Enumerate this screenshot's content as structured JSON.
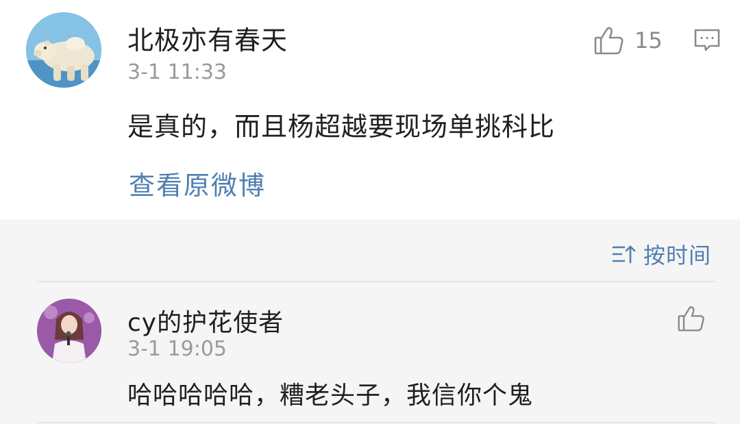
{
  "main_comment": {
    "username": "北极亦有春天",
    "timestamp": "3-1 11:33",
    "text": "是真的，而且杨超越要现场单挑科比",
    "view_original_label": "查看原微博",
    "like_count": "15",
    "avatar_icon": "polar-bear-avatar",
    "like_icon": "thumbs-up-icon",
    "comment_icon": "comment-icon"
  },
  "reply_section": {
    "sort_label": "按时间",
    "sort_icon": "sort-icon",
    "replies": [
      {
        "username": "cy的护花使者",
        "timestamp": "3-1 19:05",
        "text": "哈哈哈哈哈，糟老头子，我信你个鬼",
        "avatar_icon": "singer-avatar",
        "like_icon": "thumbs-up-icon"
      }
    ]
  },
  "colors": {
    "link_blue": "#4f7fb0",
    "muted_gray": "#9a9a9a",
    "reply_bg": "#f5f5f5"
  }
}
